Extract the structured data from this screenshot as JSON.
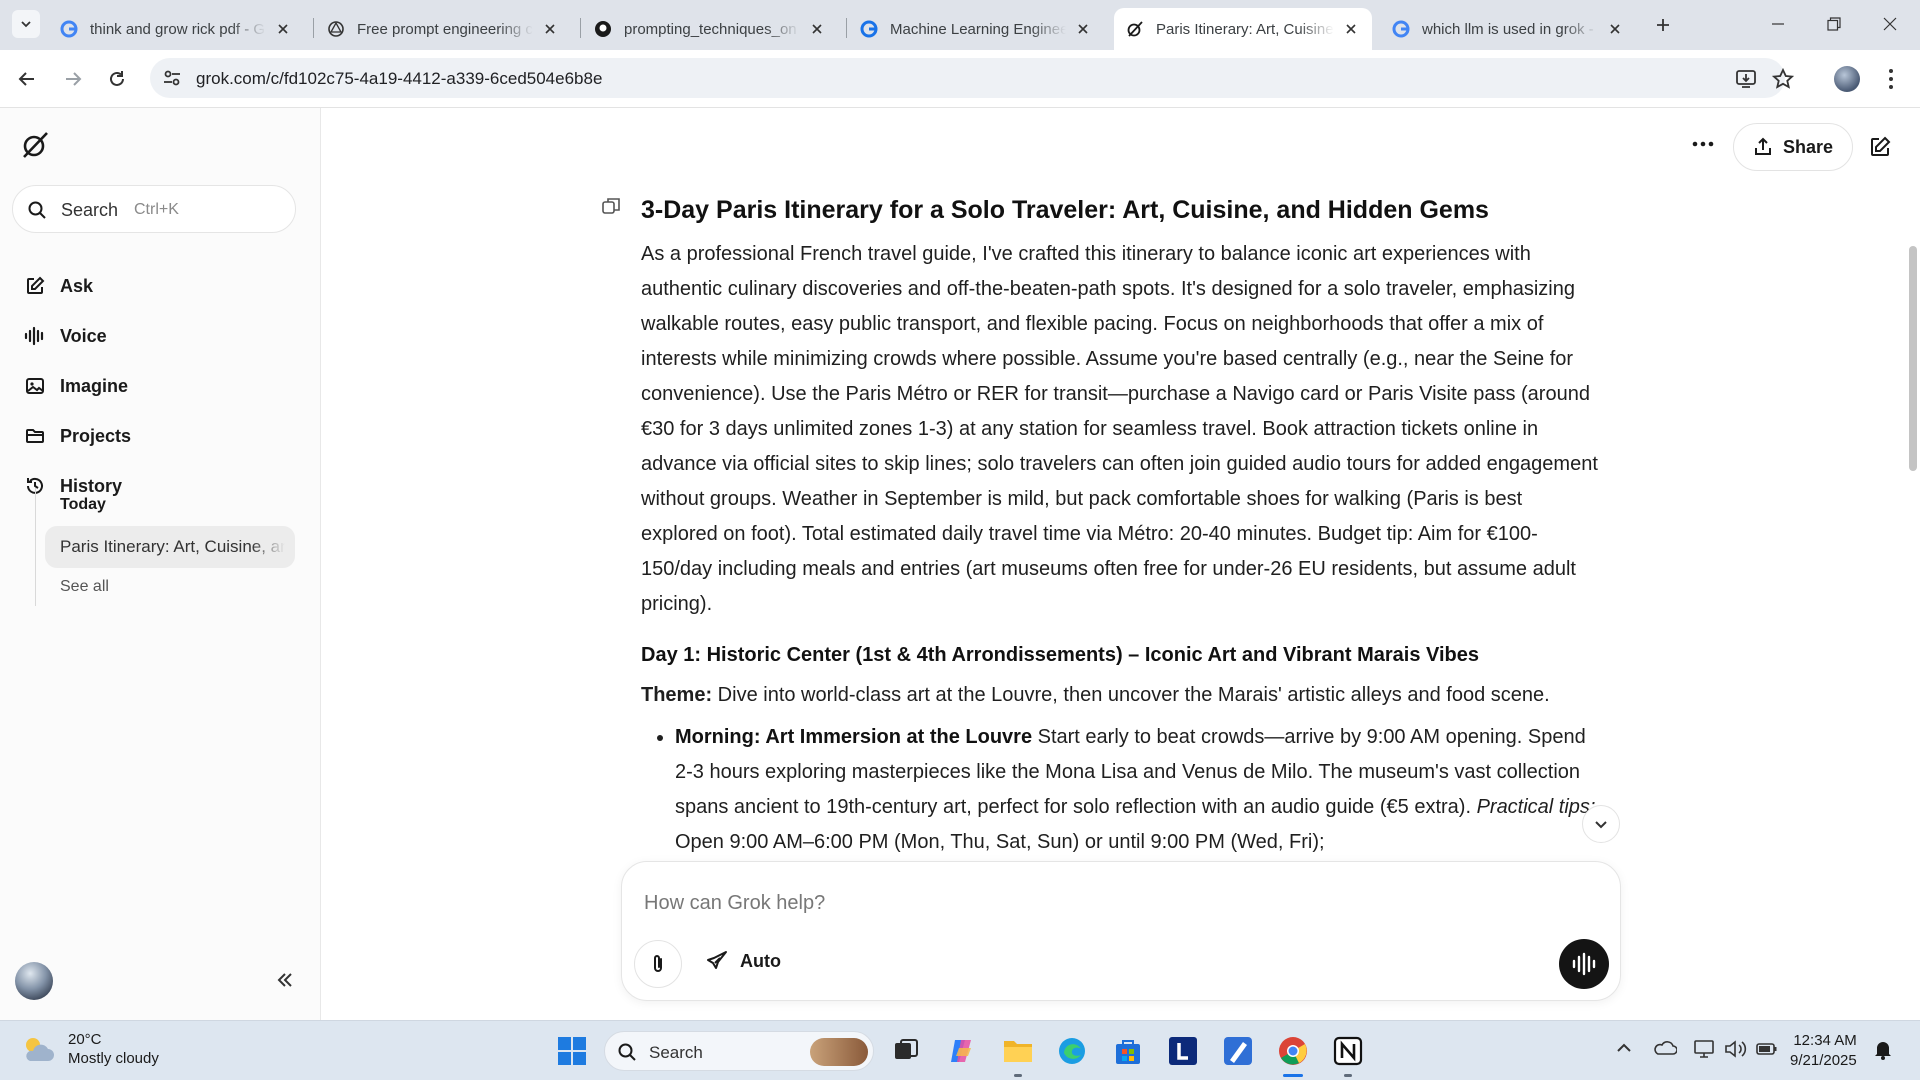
{
  "browser": {
    "tabs": [
      {
        "title": "think and grow rick pdf - G",
        "favicon": "google-icon",
        "active": false
      },
      {
        "title": "Free prompt engineering c",
        "favicon": "openai-icon",
        "active": false
      },
      {
        "title": "prompting_techniques_on",
        "favicon": "github-icon",
        "active": false
      },
      {
        "title": "Machine Learning Enginee",
        "favicon": "google-icon",
        "active": false
      },
      {
        "title": "Paris Itinerary: Art, Cuisine,",
        "favicon": "grok-icon",
        "active": true
      },
      {
        "title": "which llm is used in grok -",
        "favicon": "google-icon",
        "active": false
      }
    ],
    "url": "grok.com/c/fd102c75-4a19-4412-a339-6ced504e6b8e"
  },
  "sidebar": {
    "search_label": "Search",
    "search_shortcut": "Ctrl+K",
    "nav": [
      {
        "label": "Ask",
        "icon": "edit-icon"
      },
      {
        "label": "Voice",
        "icon": "waveform-icon"
      },
      {
        "label": "Imagine",
        "icon": "image-icon"
      },
      {
        "label": "Projects",
        "icon": "folder-icon"
      },
      {
        "label": "History",
        "icon": "history-icon"
      }
    ],
    "history": {
      "today_label": "Today",
      "items": [
        "Paris Itinerary: Art, Cuisine, and Hidden Gems"
      ],
      "see_all": "See all"
    }
  },
  "header": {
    "share_label": "Share"
  },
  "conversation": {
    "title": "3-Day Paris Itinerary for a Solo Traveler: Art, Cuisine, and Hidden Gems",
    "intro": "As a professional French travel guide, I've crafted this itinerary to balance iconic art experiences with authentic culinary discoveries and off-the-beaten-path spots. It's designed for a solo traveler, emphasizing walkable routes, easy public transport, and flexible pacing. Focus on neighborhoods that offer a mix of interests while minimizing crowds where possible. Assume you're based centrally (e.g., near the Seine for convenience). Use the Paris Métro or RER for transit—purchase a Navigo card or Paris Visite pass (around €30 for 3 days unlimited zones 1-3) at any station for seamless travel. Book attraction tickets online in advance via official sites to skip lines; solo travelers can often join guided audio tours for added engagement without groups. Weather in September is mild, but pack comfortable shoes for walking (Paris is best explored on foot). Total estimated daily travel time via Métro: 20-40 minutes. Budget tip: Aim for €100-150/day including meals and entries (art museums often free for under-26 EU residents, but assume adult pricing).",
    "day1_heading": "Day 1: Historic Center (1st & 4th Arrondissements) – Iconic Art and Vibrant Marais Vibes",
    "theme_label": "Theme:",
    "theme_text": " Dive into world-class art at the Louvre, then uncover the Marais' artistic alleys and food scene.",
    "morning_label": "Morning: Art Immersion at the Louvre",
    "morning_text": " Start early to beat crowds—arrive by 9:00 AM opening. Spend 2-3 hours exploring masterpieces like the Mona Lisa and Venus de Milo. The museum's vast collection spans ancient to 19th-century art, perfect for solo reflection with an audio guide (€5 extra). ",
    "practical_label": "Practical tips:",
    "practical_text": " Open 9:00 AM–6:00 PM (Mon, Thu, Sat, Sun) or until 9:00 PM (Wed, Fri);"
  },
  "composer": {
    "placeholder": "How can Grok help?",
    "mode_label": "Auto"
  },
  "taskbar": {
    "weather_temp": "20°C",
    "weather_desc": "Mostly cloudy",
    "search_label": "Search",
    "time": "12:34 AM",
    "date": "9/21/2025"
  }
}
